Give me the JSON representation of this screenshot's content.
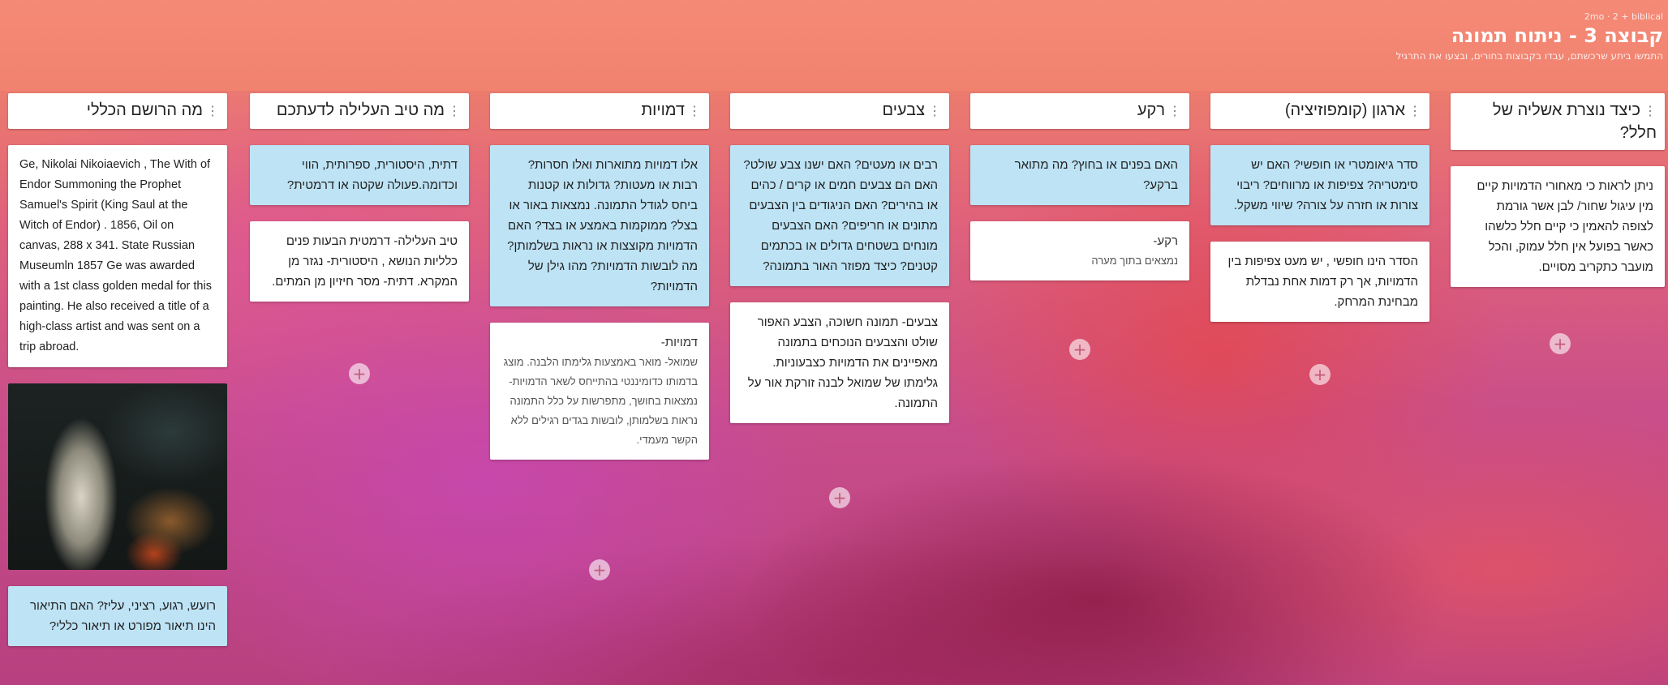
{
  "header": {
    "crumbs": "2mo · 2 + biblical",
    "title": "קבוצה 3 - ניתוח תמונה",
    "subtitle": "התמשו ביתע שרכשתם, עבדו בקבוצות בחורים, ובצעו את התרגיל"
  },
  "columns": [
    {
      "title": "כיצד נוצרת אשליה של חלל?",
      "cards": [
        {
          "type": "white",
          "text": "ניתן לראות כי מאחורי הדמויות קיים מין עיגול שחור/ לבן אשר גורמת לצופה להאמין כי קיים חלל כלשהו כאשר בפועל אין חלל עמוק, והכל מועבר כתקריב מסויים."
        }
      ]
    },
    {
      "title": "ארגון (קומפוזיציה)",
      "cards": [
        {
          "type": "blue",
          "text": "סדר גיאומטרי או חופשי? האם יש סימטריה? צפיפות או מרווחים? ריבוי צורות או חזרה על צורה? שיווי משקל."
        },
        {
          "type": "white",
          "text": "הסדר הינו חופשי , יש מעט צפיפות בין הדמויות, אך רק דמות אחת נבדלת מבחינת המרחק."
        }
      ]
    },
    {
      "title": "רקע",
      "cards": [
        {
          "type": "blue",
          "text": "האם בפנים או בחוץ? מה מתואר ברקע?"
        },
        {
          "type": "white",
          "title": "רקע-",
          "body": "נמצאים בתוך מערה"
        }
      ]
    },
    {
      "title": "צבעים",
      "cards": [
        {
          "type": "blue",
          "text": "רבים או מעטים? האם ישנו צבע שולט? האם הם צבעים חמים או קרים / כהים או בהירים? האם הניגודים בין הצבעים מתונים או חריפים? האם הצבעים מונחים בשטחים גדולים או בכתמים קטנים? כיצד מפוזר האור בתמונה?"
        },
        {
          "type": "white",
          "text": "צבעים- תמונה חשוכה, הצבע האפור שולט והצבעים הנוכחים בתמונה מאפיינים את הדמויות כצבעוניות. גלימתו של שמואל לבנה זורקת אור על התמונה."
        }
      ]
    },
    {
      "title": "דמויות",
      "cards": [
        {
          "type": "blue",
          "text": "אלו דמויות מתוארות ואלו חסרות? רבות או מעטות? גדולות או קטנות ביחס לגודל התמונה. נמצאות באור או בצל? ממוקמות באמצע או בצד? האם הדמויות מקוצצות או נראות בשלמותן? מה לובשות הדמויות? מהו גילן של הדמויות?"
        },
        {
          "type": "white",
          "title": "דמויות-",
          "body": "שמואל- מואר באמצעות גלימתו הלבנה. מוצג בדמותו כדומיננטי בהתייחס לשאר הדמויות- נמצאות בחושך, מתפרשות על כלל התמונה נראות בשלמותן, לובשות בגדים רגילים ללא הקשר מעמדי."
        }
      ]
    },
    {
      "title": "מה טיב העלילה לדעתכם",
      "cards": [
        {
          "type": "blue",
          "text": "דתית, היסטורית, ספרותית, הווי וכדומה.פעולה שקטה או דרמטית?"
        },
        {
          "type": "white",
          "text": "טיב העלילה- דרמטית הבעות פנים כלליות הנושא , היסטורית- נגזר מן המקרא. דתית- מסר חיזיון מן המתים."
        }
      ]
    },
    {
      "title": "מה הרושם הכללי",
      "cards": [
        {
          "type": "ltr",
          "text": "Ge, Nikolai Nikoiaevich , The With of Endor Summoning the Prophet Samuel's Spirit (King Saul at the Witch of Endor) . 1856, Oil on canvas, 288 x 341. State Russian Museumln 1857 Ge was awarded with a 1st class golden medal for this painting. He also received a title of a high-class artist and was sent on a trip abroad."
        },
        {
          "type": "image",
          "label": "King Saul at the Witch of Endor painting"
        },
        {
          "type": "blue",
          "text": "רועש, רגוע, רציני, עליז? האם התיאור הינו תיאור מפורט או תיאור כללי?"
        }
      ]
    }
  ],
  "add_symbol": "+",
  "drag_symbol": "⋮"
}
